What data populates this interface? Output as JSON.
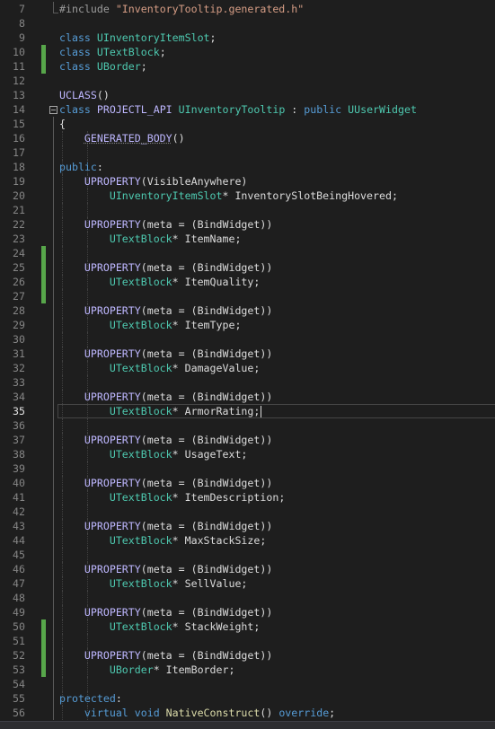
{
  "editor": {
    "current_line": 35,
    "lines": [
      {
        "n": "7",
        "tokens": [
          {
            "c": "pre",
            "t": "#include "
          },
          {
            "c": "str",
            "t": "\"InventoryTooltip.generated.h\""
          }
        ]
      },
      {
        "n": "8",
        "tokens": []
      },
      {
        "n": "9",
        "tokens": [
          {
            "c": "kw",
            "t": "class "
          },
          {
            "c": "type",
            "t": "UInventoryItemSlot"
          },
          {
            "c": "plain",
            "t": ";"
          }
        ]
      },
      {
        "n": "10",
        "tokens": [
          {
            "c": "kw",
            "t": "class "
          },
          {
            "c": "type",
            "t": "UTextBlock"
          },
          {
            "c": "plain",
            "t": ";"
          }
        ],
        "changed": true
      },
      {
        "n": "11",
        "tokens": [
          {
            "c": "kw",
            "t": "class "
          },
          {
            "c": "type",
            "t": "UBorder"
          },
          {
            "c": "plain",
            "t": ";"
          }
        ],
        "changed": true
      },
      {
        "n": "12",
        "tokens": []
      },
      {
        "n": "13",
        "tokens": [
          {
            "c": "macro",
            "t": "UCLASS"
          },
          {
            "c": "plain",
            "t": "()"
          }
        ]
      },
      {
        "n": "14",
        "tokens": [
          {
            "c": "kw",
            "t": "class "
          },
          {
            "c": "macro",
            "t": "PROJECTL_API "
          },
          {
            "c": "type",
            "t": "UInventoryTooltip"
          },
          {
            "c": "plain",
            "t": " : "
          },
          {
            "c": "kw",
            "t": "public "
          },
          {
            "c": "type",
            "t": "UUserWidget"
          }
        ],
        "fold": true
      },
      {
        "n": "15",
        "tokens": [
          {
            "c": "plain",
            "t": "{"
          }
        ]
      },
      {
        "n": "16",
        "tokens": [
          {
            "c": "plain",
            "t": "    "
          },
          {
            "c": "macro squiggle",
            "t": "GENERATED_BODY"
          },
          {
            "c": "plain",
            "t": "()"
          }
        ]
      },
      {
        "n": "17",
        "tokens": []
      },
      {
        "n": "18",
        "tokens": [
          {
            "c": "kw",
            "t": "public"
          },
          {
            "c": "plain",
            "t": ":"
          }
        ]
      },
      {
        "n": "19",
        "tokens": [
          {
            "c": "plain",
            "t": "    "
          },
          {
            "c": "macro",
            "t": "UPROPERTY"
          },
          {
            "c": "plain",
            "t": "(VisibleAnywhere)"
          }
        ]
      },
      {
        "n": "20",
        "tokens": [
          {
            "c": "plain",
            "t": "        "
          },
          {
            "c": "type",
            "t": "UInventoryItemSlot"
          },
          {
            "c": "plain",
            "t": "* InventorySlotBeingHovered;"
          }
        ]
      },
      {
        "n": "21",
        "tokens": []
      },
      {
        "n": "22",
        "tokens": [
          {
            "c": "plain",
            "t": "    "
          },
          {
            "c": "macro",
            "t": "UPROPERTY"
          },
          {
            "c": "plain",
            "t": "(meta = (BindWidget))"
          }
        ]
      },
      {
        "n": "23",
        "tokens": [
          {
            "c": "plain",
            "t": "        "
          },
          {
            "c": "type",
            "t": "UTextBlock"
          },
          {
            "c": "plain",
            "t": "* ItemName;"
          }
        ]
      },
      {
        "n": "24",
        "tokens": [],
        "changed": true
      },
      {
        "n": "25",
        "tokens": [
          {
            "c": "plain",
            "t": "    "
          },
          {
            "c": "macro",
            "t": "UPROPERTY"
          },
          {
            "c": "plain",
            "t": "(meta = (BindWidget))"
          }
        ],
        "changed": true
      },
      {
        "n": "26",
        "tokens": [
          {
            "c": "plain",
            "t": "        "
          },
          {
            "c": "type",
            "t": "UTextBlock"
          },
          {
            "c": "plain",
            "t": "* ItemQuality;"
          }
        ],
        "changed": true
      },
      {
        "n": "27",
        "tokens": [],
        "changed": true
      },
      {
        "n": "28",
        "tokens": [
          {
            "c": "plain",
            "t": "    "
          },
          {
            "c": "macro",
            "t": "UPROPERTY"
          },
          {
            "c": "plain",
            "t": "(meta = (BindWidget))"
          }
        ]
      },
      {
        "n": "29",
        "tokens": [
          {
            "c": "plain",
            "t": "        "
          },
          {
            "c": "type",
            "t": "UTextBlock"
          },
          {
            "c": "plain",
            "t": "* ItemType;"
          }
        ]
      },
      {
        "n": "30",
        "tokens": []
      },
      {
        "n": "31",
        "tokens": [
          {
            "c": "plain",
            "t": "    "
          },
          {
            "c": "macro",
            "t": "UPROPERTY"
          },
          {
            "c": "plain",
            "t": "(meta = (BindWidget))"
          }
        ]
      },
      {
        "n": "32",
        "tokens": [
          {
            "c": "plain",
            "t": "        "
          },
          {
            "c": "type",
            "t": "UTextBlock"
          },
          {
            "c": "plain",
            "t": "* DamageValue;"
          }
        ]
      },
      {
        "n": "33",
        "tokens": []
      },
      {
        "n": "34",
        "tokens": [
          {
            "c": "plain",
            "t": "    "
          },
          {
            "c": "macro",
            "t": "UPROPERTY"
          },
          {
            "c": "plain",
            "t": "(meta = (BindWidget))"
          }
        ]
      },
      {
        "n": "35",
        "tokens": [
          {
            "c": "plain",
            "t": "        "
          },
          {
            "c": "type",
            "t": "UTextBlock"
          },
          {
            "c": "plain",
            "t": "* ArmorRating;"
          }
        ],
        "caret": true
      },
      {
        "n": "36",
        "tokens": []
      },
      {
        "n": "37",
        "tokens": [
          {
            "c": "plain",
            "t": "    "
          },
          {
            "c": "macro",
            "t": "UPROPERTY"
          },
          {
            "c": "plain",
            "t": "(meta = (BindWidget))"
          }
        ]
      },
      {
        "n": "38",
        "tokens": [
          {
            "c": "plain",
            "t": "        "
          },
          {
            "c": "type",
            "t": "UTextBlock"
          },
          {
            "c": "plain",
            "t": "* UsageText;"
          }
        ]
      },
      {
        "n": "39",
        "tokens": []
      },
      {
        "n": "40",
        "tokens": [
          {
            "c": "plain",
            "t": "    "
          },
          {
            "c": "macro",
            "t": "UPROPERTY"
          },
          {
            "c": "plain",
            "t": "(meta = (BindWidget))"
          }
        ]
      },
      {
        "n": "41",
        "tokens": [
          {
            "c": "plain",
            "t": "        "
          },
          {
            "c": "type",
            "t": "UTextBlock"
          },
          {
            "c": "plain",
            "t": "* ItemDescription;"
          }
        ]
      },
      {
        "n": "42",
        "tokens": []
      },
      {
        "n": "43",
        "tokens": [
          {
            "c": "plain",
            "t": "    "
          },
          {
            "c": "macro",
            "t": "UPROPERTY"
          },
          {
            "c": "plain",
            "t": "(meta = (BindWidget))"
          }
        ]
      },
      {
        "n": "44",
        "tokens": [
          {
            "c": "plain",
            "t": "        "
          },
          {
            "c": "type",
            "t": "UTextBlock"
          },
          {
            "c": "plain",
            "t": "* MaxStackSize;"
          }
        ]
      },
      {
        "n": "45",
        "tokens": []
      },
      {
        "n": "46",
        "tokens": [
          {
            "c": "plain",
            "t": "    "
          },
          {
            "c": "macro",
            "t": "UPROPERTY"
          },
          {
            "c": "plain",
            "t": "(meta = (BindWidget))"
          }
        ]
      },
      {
        "n": "47",
        "tokens": [
          {
            "c": "plain",
            "t": "        "
          },
          {
            "c": "type",
            "t": "UTextBlock"
          },
          {
            "c": "plain",
            "t": "* SellValue;"
          }
        ]
      },
      {
        "n": "48",
        "tokens": []
      },
      {
        "n": "49",
        "tokens": [
          {
            "c": "plain",
            "t": "    "
          },
          {
            "c": "macro",
            "t": "UPROPERTY"
          },
          {
            "c": "plain",
            "t": "(meta = (BindWidget))"
          }
        ]
      },
      {
        "n": "50",
        "tokens": [
          {
            "c": "plain",
            "t": "        "
          },
          {
            "c": "type",
            "t": "UTextBlock"
          },
          {
            "c": "plain",
            "t": "* StackWeight;"
          }
        ],
        "changed": true
      },
      {
        "n": "51",
        "tokens": [],
        "changed": true
      },
      {
        "n": "52",
        "tokens": [
          {
            "c": "plain",
            "t": "    "
          },
          {
            "c": "macro",
            "t": "UPROPERTY"
          },
          {
            "c": "plain",
            "t": "(meta = (BindWidget))"
          }
        ],
        "changed": true
      },
      {
        "n": "53",
        "tokens": [
          {
            "c": "plain",
            "t": "        "
          },
          {
            "c": "type",
            "t": "UBorder"
          },
          {
            "c": "plain",
            "t": "* ItemBorder;"
          }
        ],
        "changed": true
      },
      {
        "n": "54",
        "tokens": []
      },
      {
        "n": "55",
        "tokens": [
          {
            "c": "kw",
            "t": "protected"
          },
          {
            "c": "plain",
            "t": ":"
          }
        ]
      },
      {
        "n": "56",
        "tokens": [
          {
            "c": "plain",
            "t": "    "
          },
          {
            "c": "kw",
            "t": "virtual void "
          },
          {
            "c": "func",
            "t": "NativeConstruct"
          },
          {
            "c": "plain",
            "t": "() "
          },
          {
            "c": "kw",
            "t": "override"
          },
          {
            "c": "plain",
            "t": ";"
          }
        ]
      }
    ]
  },
  "colors": {
    "background": "#1e1e1e",
    "keyword": "#569cd6",
    "type": "#4ec9b0",
    "macro": "#beb7ff",
    "string": "#d69d85",
    "function": "#dcdcaa",
    "text": "#dcdcdc",
    "change_saved": "#57a64a",
    "line_number": "#858585"
  }
}
